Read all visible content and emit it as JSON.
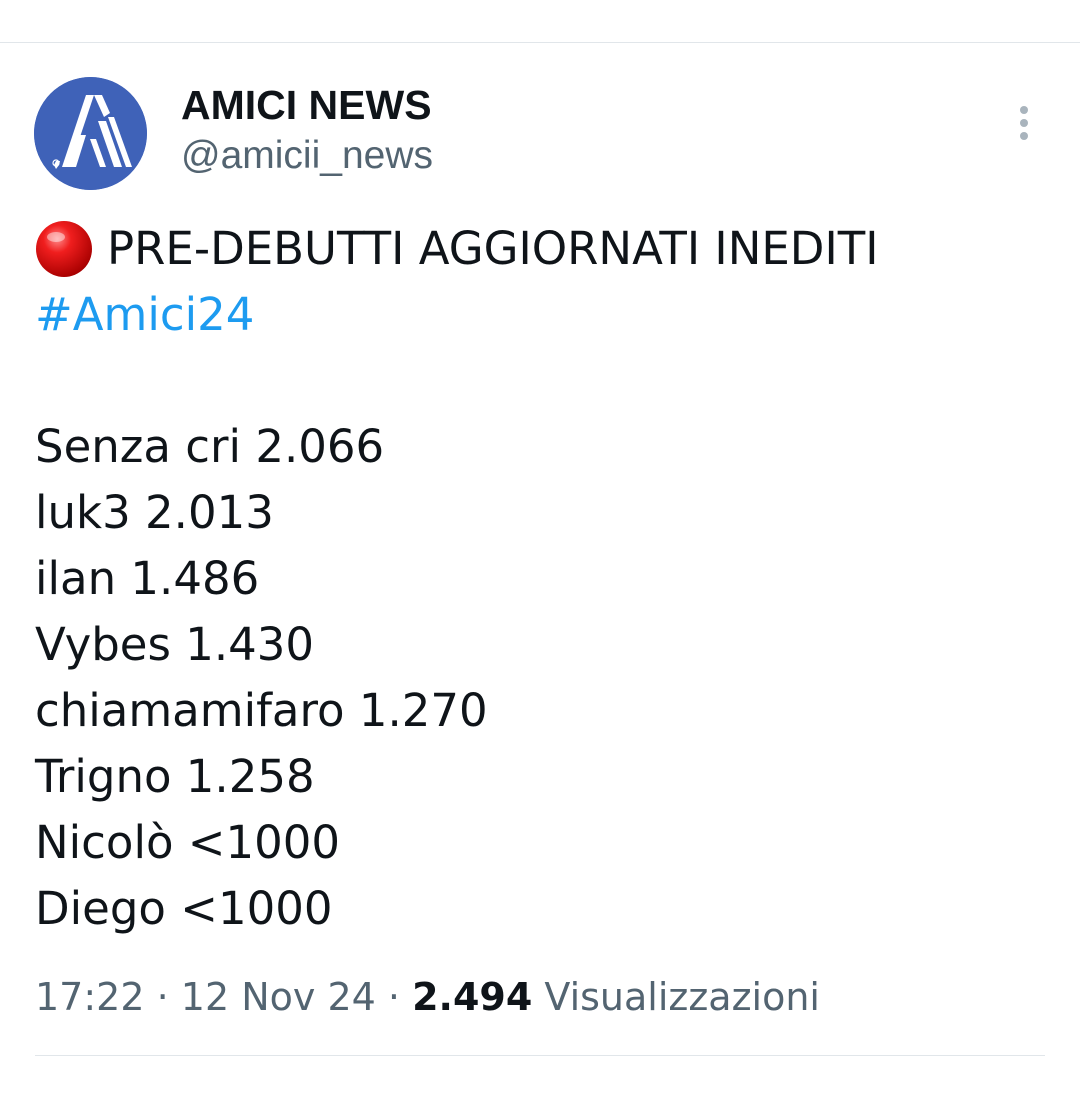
{
  "author": {
    "name": "AMICI NEWS",
    "handle": "@amicii_news",
    "avatar_icon": "amici-logo",
    "avatar_color": "#3f62b8"
  },
  "menu": {
    "icon": "more-vertical-icon"
  },
  "tweet": {
    "headline_icon": "red-circle-icon",
    "headline": "PRE-DEBUTTI AGGIORNATI INEDITI",
    "hashtag": "#Amici24",
    "hashtag_color": "#1d9bf0",
    "entries": [
      "Senza cri 2.066",
      "luk3 2.013",
      "ilan 1.486",
      "Vybes 1.430",
      "chiamamifaro 1.270",
      "Trigno 1.258",
      "Nicolò <1000",
      "Diego <1000"
    ]
  },
  "meta": {
    "time": "17:22",
    "separator": "·",
    "date": "12 Nov 24",
    "views_count": "2.494",
    "views_label": "Visualizzazioni"
  }
}
